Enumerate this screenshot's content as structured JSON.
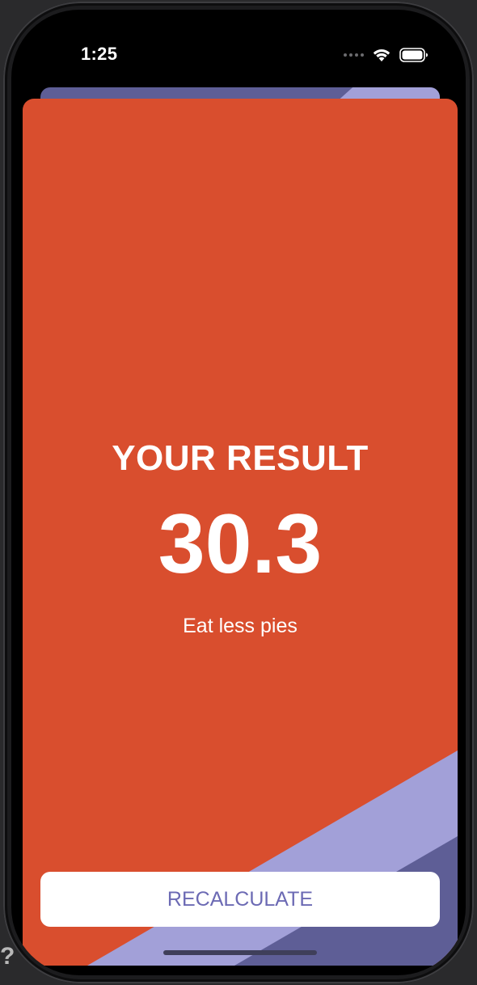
{
  "status_bar": {
    "time": "1:25",
    "wifi_icon": "wifi-icon",
    "battery_icon": "battery-icon"
  },
  "result": {
    "title": "YOUR RESULT",
    "value": "30.3",
    "advice": "Eat less pies"
  },
  "actions": {
    "recalculate_label": "RECALCULATE"
  },
  "colors": {
    "card_background": "#d94e2e",
    "accent_purple": "#6c6ab4",
    "stripe_light": "#a2a0d8",
    "stripe_dark": "#5e5e96"
  },
  "help_glyph": "?"
}
